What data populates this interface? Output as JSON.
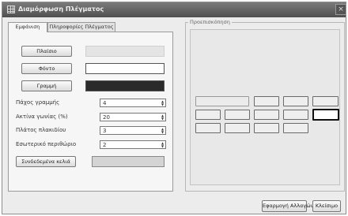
{
  "window": {
    "title": "Διαμόρφωση Πλέγματος",
    "close_glyph": "×"
  },
  "tabs": [
    {
      "label": "Εμφάνιση",
      "active": true
    },
    {
      "label": "Πληροφορίες Πλέγματος",
      "active": false
    }
  ],
  "appearance": {
    "frame_label": "Πλαίσιο",
    "background_label": "Φόντο",
    "line_label": "Γραμμή",
    "frame_color": "#e4e4e4",
    "background_color": "#ffffff",
    "line_color": "#2a2a2a",
    "line_width_label": "Πάχος γραμμής",
    "line_width_value": "4",
    "corner_radius_label": "Ακτίνα γωνίας (%)",
    "corner_radius_value": "20",
    "cell_width_label": "Πλάτος πλακιδίου",
    "cell_width_value": "3",
    "padding_label": "Εσωτερικό περιθώριο",
    "padding_value": "2",
    "linked_cells_label": "Συνδεδεμένα κελιά",
    "linked_cells_color": "#d4d4d4"
  },
  "preview": {
    "legend": "Προεπισκόπηση"
  },
  "footer": {
    "apply_label": "Εφαρμογή Αλλαγών",
    "close_label": "Κλείσιμο"
  },
  "icons": {
    "window": "grid-icon",
    "spin_up": "▲",
    "spin_down": "▼"
  }
}
